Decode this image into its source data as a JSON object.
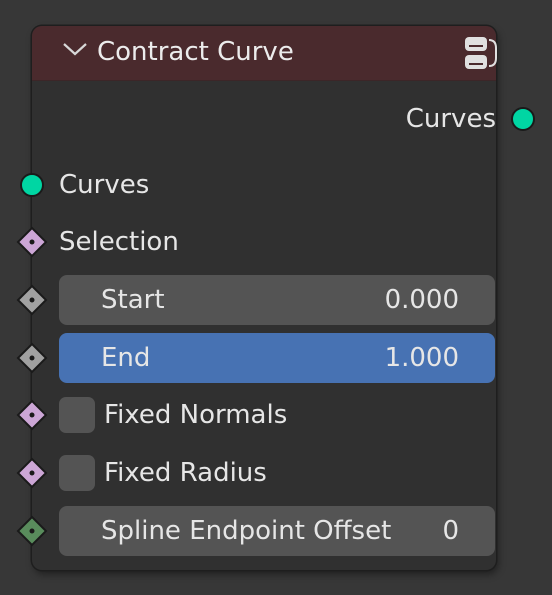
{
  "node": {
    "title": "Contract Curve",
    "header_color": "#4a2a2d",
    "outputs": [
      {
        "label": "Curves",
        "socket": "geometry",
        "color": "#00d6a3"
      }
    ],
    "inputs": [
      {
        "label": "Curves",
        "socket": "geometry",
        "color": "#00d6a3"
      },
      {
        "label": "Selection",
        "socket": "boolean",
        "color": "#cca6d6"
      },
      {
        "label": "Start",
        "value": "0.000",
        "socket": "float",
        "color": "#a1a1a1"
      },
      {
        "label": "End",
        "value": "1.000",
        "socket": "float",
        "color": "#a1a1a1",
        "active": true,
        "field_color": "#4772b3"
      },
      {
        "label": "Fixed Normals",
        "checked": false,
        "socket": "boolean",
        "color": "#cca6d6"
      },
      {
        "label": "Fixed Radius",
        "checked": false,
        "socket": "boolean",
        "color": "#cca6d6"
      },
      {
        "label": "Spline Endpoint Offset",
        "value": "0",
        "socket": "integer",
        "color": "#598c5c"
      }
    ]
  }
}
